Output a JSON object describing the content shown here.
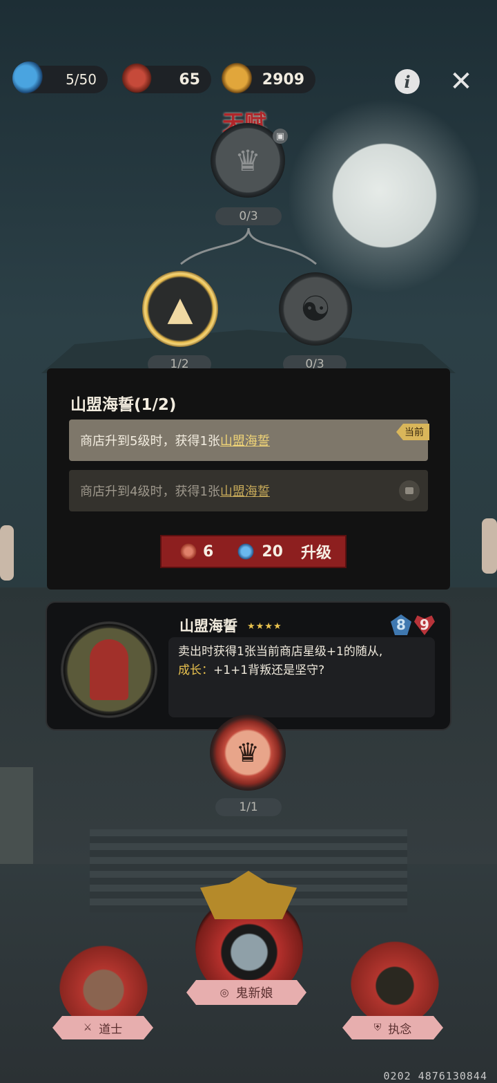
{
  "resources": {
    "potion": "5/50",
    "chain": "65",
    "coin": "2909"
  },
  "header": {
    "title": "天赋"
  },
  "talent_tree": {
    "top_count": "0/3",
    "left_count": "1/2",
    "right_count": "0/3",
    "bottom_count": "1/1"
  },
  "popup": {
    "title": "山盟海誓(1/2)",
    "rows": [
      {
        "prefix": "商店升到5级时，获得1张",
        "link": "山盟海誓",
        "tag": "当前"
      },
      {
        "prefix": "商店升到4级时，获得1张",
        "link": "山盟海誓"
      }
    ],
    "cost_chain": "6",
    "cost_potion": "20",
    "upgrade_label": "升级"
  },
  "card": {
    "name": "山盟海誓",
    "stars": "★★★★",
    "attack": "8",
    "health": "9",
    "desc_line1": "卖出时获得1张当前商店星级+1的随从,",
    "growth_label": "成长：",
    "growth_text": "+1+1背叛还是坚守?"
  },
  "heroes": {
    "left_label": "道士",
    "center_label": "鬼新娘",
    "right_label": "执念"
  },
  "footer_id": "0202 4876130844",
  "colors": {
    "panel_bg": "#121212",
    "upgrade_red": "#8d1f1f",
    "gold": "#e9c24e",
    "hero_label_pink": "#e7aeae"
  },
  "icons": [
    "potion-icon",
    "chain-icon",
    "coin-icon",
    "info-icon",
    "close-icon",
    "lock-icon",
    "yin-yang-icon",
    "hood-icon",
    "crown-icon",
    "shield-icon",
    "sword-icon",
    "heart-icon",
    "gem-icon"
  ]
}
